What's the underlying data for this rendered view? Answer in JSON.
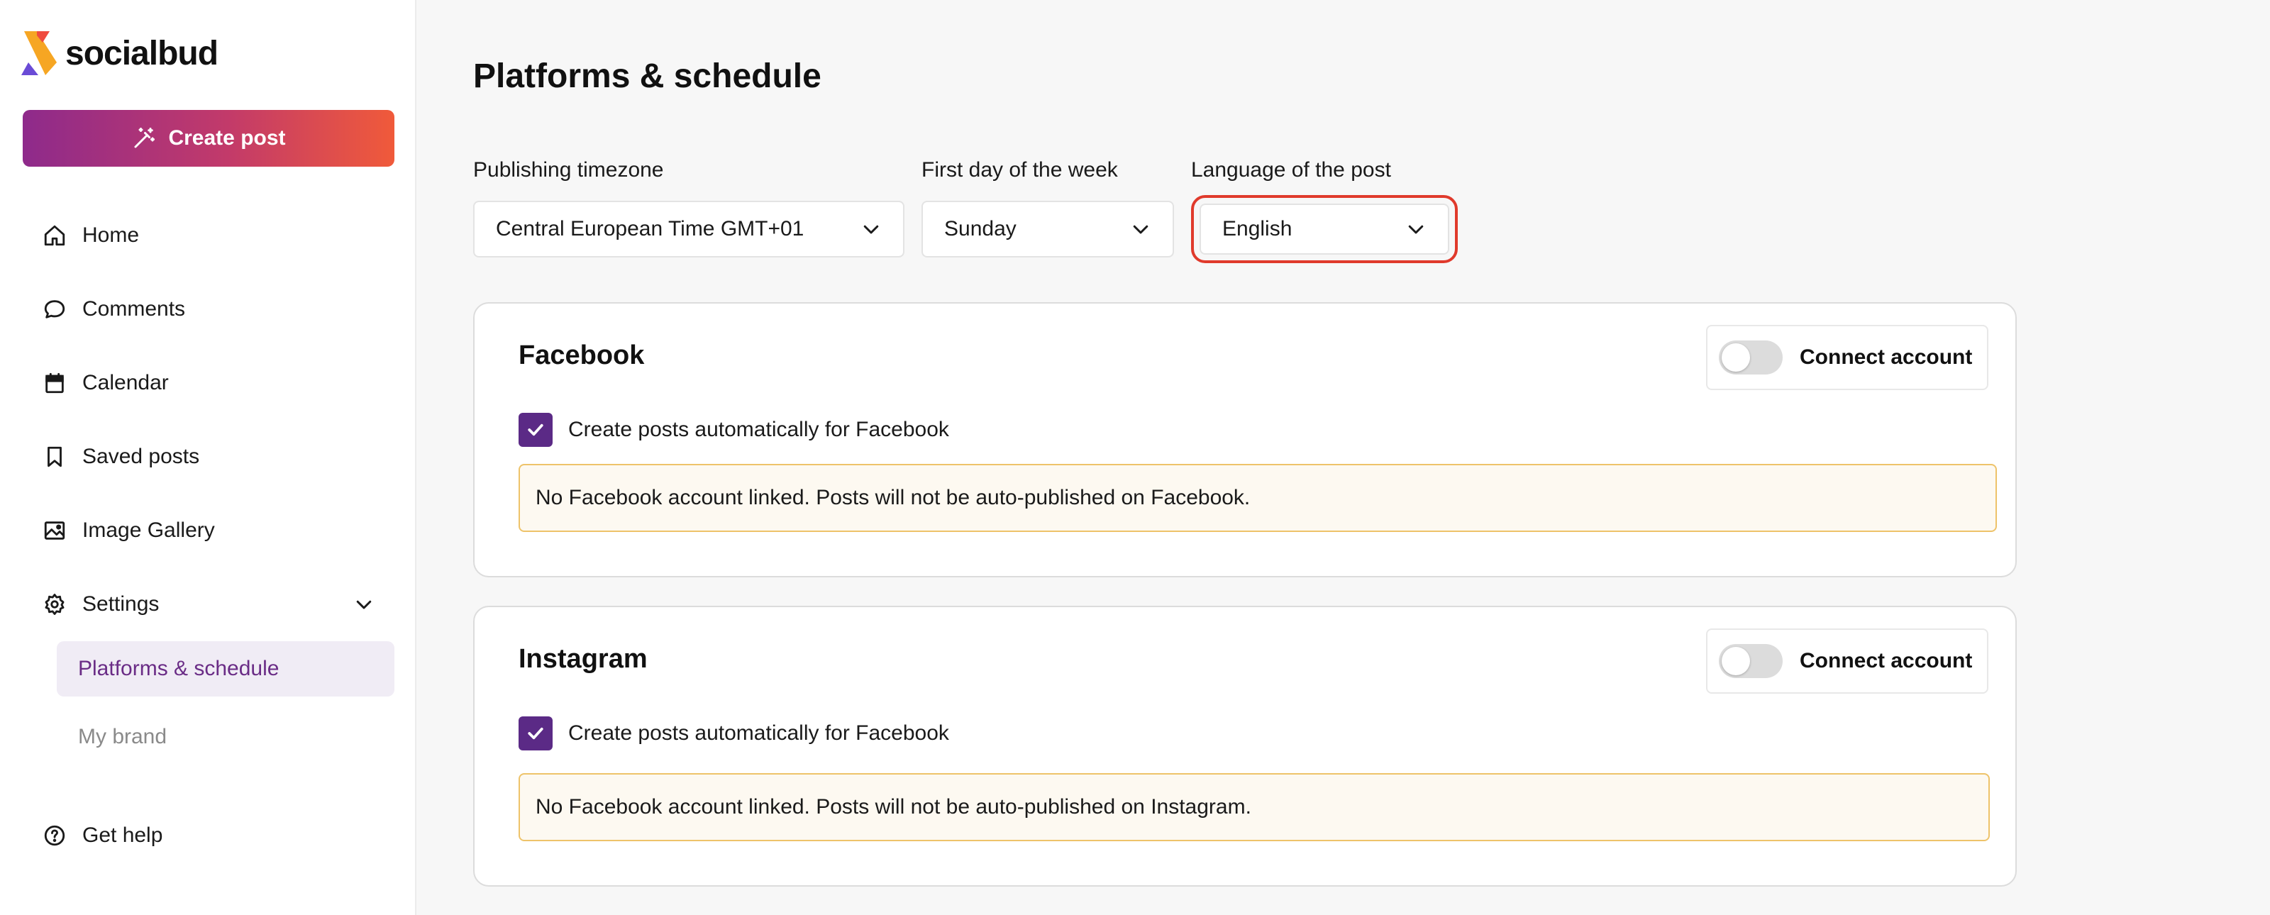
{
  "brand": {
    "name": "socialbud"
  },
  "sidebar": {
    "create_label": "Create post",
    "items": [
      {
        "label": "Home",
        "icon": "home-icon"
      },
      {
        "label": "Comments",
        "icon": "comment-icon"
      },
      {
        "label": "Calendar",
        "icon": "calendar-icon"
      },
      {
        "label": "Saved posts",
        "icon": "bookmark-icon"
      },
      {
        "label": "Image Gallery",
        "icon": "image-icon"
      },
      {
        "label": "Settings",
        "icon": "gear-icon"
      }
    ],
    "sub_items": [
      {
        "label": "Platforms & schedule",
        "active": true
      },
      {
        "label": "My brand",
        "active": false
      }
    ],
    "help_label": "Get help"
  },
  "main": {
    "title": "Platforms & schedule",
    "fields": {
      "timezone": {
        "label": "Publishing timezone",
        "value": "Central European Time GMT+01"
      },
      "first_day": {
        "label": "First day of the week",
        "value": "Sunday"
      },
      "language": {
        "label": "Language of the post",
        "value": "English"
      }
    },
    "platforms": [
      {
        "name": "Facebook",
        "connect_label": "Connect account",
        "connected": false,
        "auto_label": "Create posts automatically for Facebook",
        "auto_checked": true,
        "warning": "No Facebook account linked. Posts will not be auto-published on Facebook."
      },
      {
        "name": "Instagram",
        "connect_label": "Connect account",
        "connected": false,
        "auto_label": "Create posts automatically for Facebook",
        "auto_checked": true,
        "warning": "No Facebook account linked. Posts will not be auto-published on Instagram."
      }
    ]
  },
  "colors": {
    "accent": "#5b2a86",
    "highlight_outline": "#e03a2c",
    "warning_border": "#eec36a",
    "warning_bg": "#fdf9f1"
  }
}
